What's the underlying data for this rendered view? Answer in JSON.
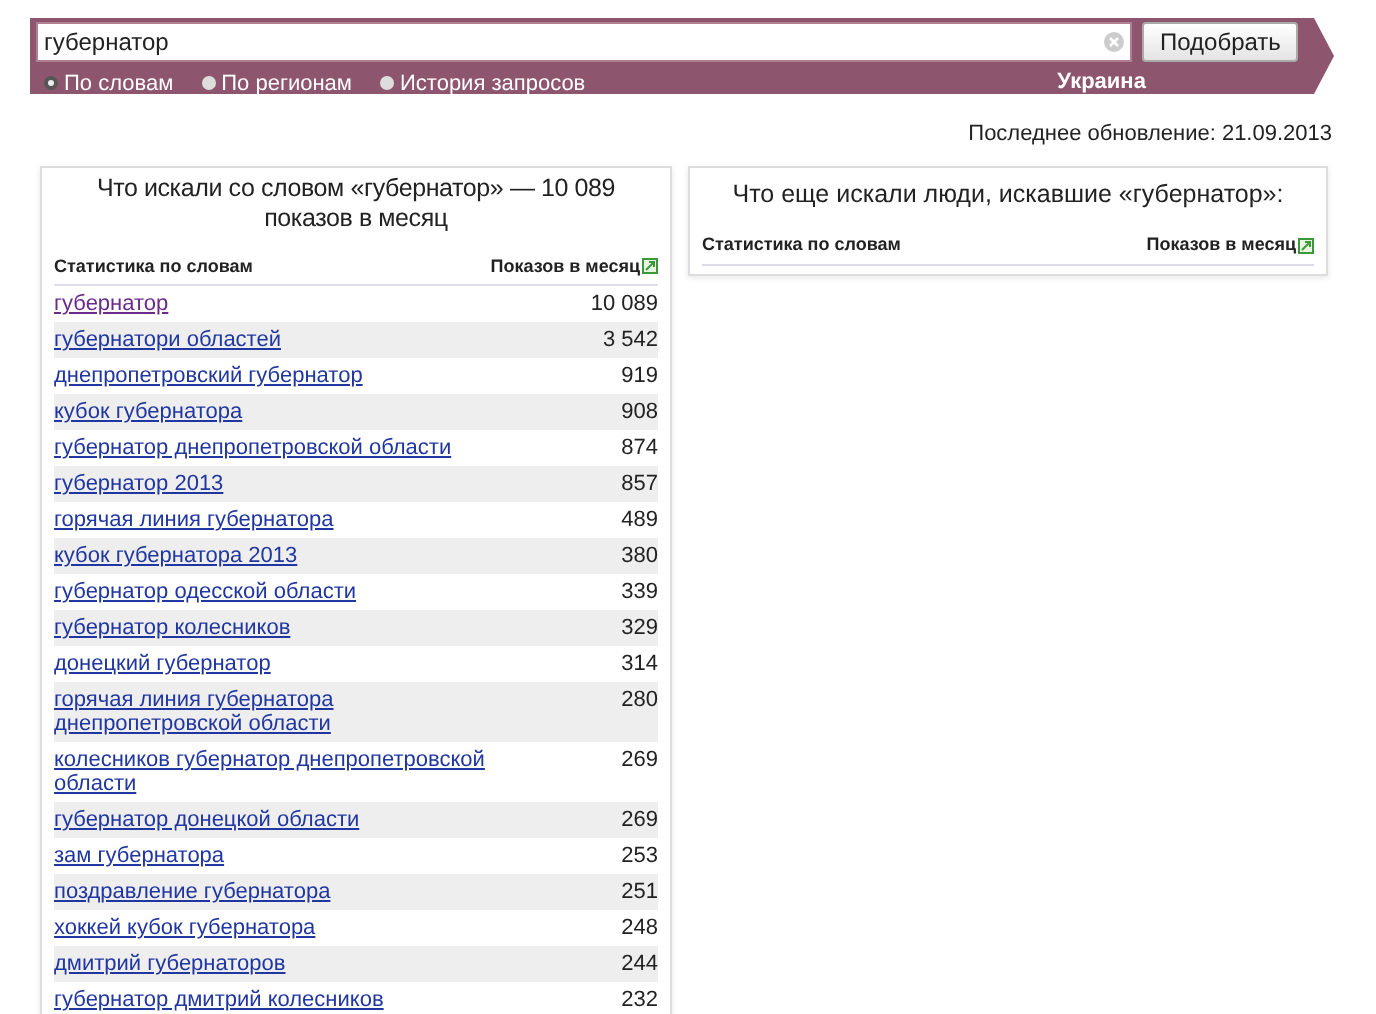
{
  "search": {
    "value": "губернатор",
    "button": "Подобрать"
  },
  "modes": [
    {
      "label": "По словам",
      "selected": true
    },
    {
      "label": "По регионам",
      "selected": false
    },
    {
      "label": "История запросов",
      "selected": false
    }
  ],
  "region": "Украина",
  "updated": "Последнее обновление: 21.09.2013",
  "left": {
    "title": "Что искали со словом «губернатор» — 10 089 показов в месяц",
    "columns": [
      "Статистика по словам",
      "Показов в месяц"
    ],
    "rows": [
      {
        "phrase": "губернатор",
        "count": "10 089",
        "visited": true
      },
      {
        "phrase": "губернатори областей",
        "count": "3 542",
        "visited": false
      },
      {
        "phrase": "днепропетровский губернатор",
        "count": "919",
        "visited": false
      },
      {
        "phrase": "кубок губернатора",
        "count": "908",
        "visited": false
      },
      {
        "phrase": "губернатор днепропетровской области",
        "count": "874",
        "visited": false
      },
      {
        "phrase": "губернатор 2013",
        "count": "857",
        "visited": false
      },
      {
        "phrase": "горячая линия губернатора",
        "count": "489",
        "visited": false
      },
      {
        "phrase": "кубок губернатора 2013",
        "count": "380",
        "visited": false
      },
      {
        "phrase": "губернатор одесской области",
        "count": "339",
        "visited": false
      },
      {
        "phrase": "губернатор колесников",
        "count": "329",
        "visited": false
      },
      {
        "phrase": "донецкий губернатор",
        "count": "314",
        "visited": false
      },
      {
        "phrase": "горячая линия губернатора днепропетровской области",
        "count": "280",
        "visited": false
      },
      {
        "phrase": "колесников губернатор днепропетровской области",
        "count": "269",
        "visited": false
      },
      {
        "phrase": "губернатор донецкой области",
        "count": "269",
        "visited": false
      },
      {
        "phrase": "зам губернатора",
        "count": "253",
        "visited": false
      },
      {
        "phrase": "поздравление губернатора",
        "count": "251",
        "visited": false
      },
      {
        "phrase": "хоккей кубок губернатора",
        "count": "248",
        "visited": false
      },
      {
        "phrase": "дмитрий губернаторов",
        "count": "244",
        "visited": false
      },
      {
        "phrase": "губернатор дмитрий колесников",
        "count": "232",
        "visited": false
      }
    ]
  },
  "right": {
    "title": "Что еще искали люди, искавшие «губернатор»:",
    "columns": [
      "Статистика по словам",
      "Показов в месяц"
    ]
  }
}
